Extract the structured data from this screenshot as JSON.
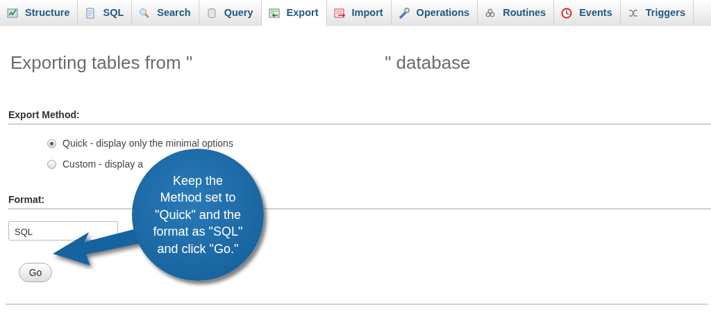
{
  "tabs": [
    {
      "label": "Structure",
      "selected": false
    },
    {
      "label": "SQL",
      "selected": false
    },
    {
      "label": "Search",
      "selected": false
    },
    {
      "label": "Query",
      "selected": false
    },
    {
      "label": "Export",
      "selected": true
    },
    {
      "label": "Import",
      "selected": false
    },
    {
      "label": "Operations",
      "selected": false
    },
    {
      "label": "Routines",
      "selected": false
    },
    {
      "label": "Events",
      "selected": false
    },
    {
      "label": "Triggers",
      "selected": false
    }
  ],
  "heading": {
    "start": "Exporting tables from \"",
    "end": "\" database"
  },
  "export_method": {
    "label": "Export Method:",
    "options": [
      {
        "label": "Quick - display only the minimal options",
        "selected": true
      },
      {
        "label": "Custom - display a",
        "selected": false
      }
    ]
  },
  "format": {
    "label": "Format:",
    "value": "SQL"
  },
  "go_button": "Go",
  "callout": {
    "lines": [
      "Keep the",
      "Method set to",
      "\"Quick\" and the",
      "format as \"SQL\"",
      "and click \"Go.\""
    ]
  }
}
